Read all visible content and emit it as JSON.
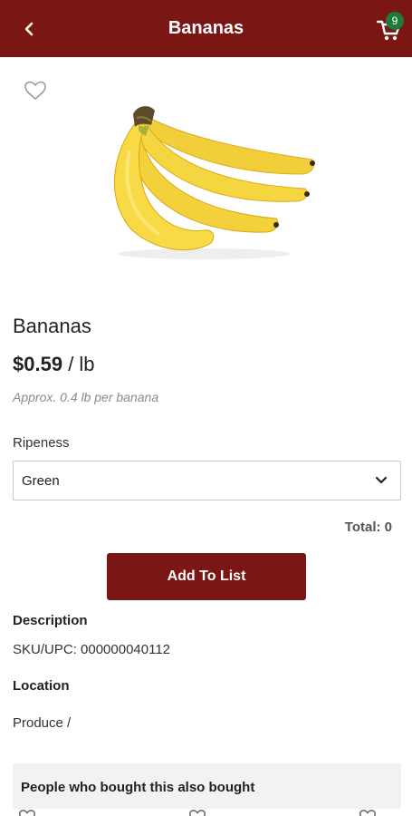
{
  "header": {
    "title": "Bananas",
    "cart_count": "9",
    "background": "#7a1614",
    "badge_color": "#1f7a3a"
  },
  "product": {
    "image": "banana-bunch-image",
    "name": "Bananas",
    "price": "$0.59",
    "unit": "/ lb",
    "approx_note": "Approx. 0.4 lb per banana"
  },
  "ripeness": {
    "label": "Ripeness",
    "selected": "Green"
  },
  "total_text": "Total: 0",
  "add_button_label": "Add To List",
  "description": {
    "heading": "Description",
    "sku": "SKU/UPC: 000000040112"
  },
  "location": {
    "heading": "Location",
    "value": "Produce /"
  },
  "also_bought": {
    "heading": "People who bought this also bought"
  }
}
